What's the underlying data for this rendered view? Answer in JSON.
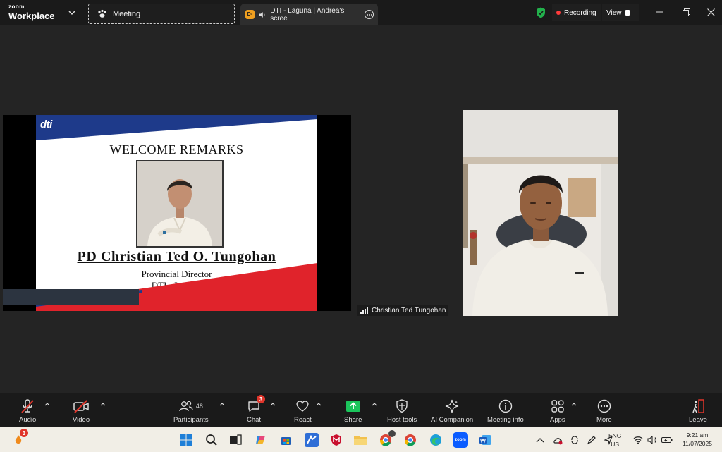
{
  "app": {
    "brand_small": "zoom",
    "brand_big": "Workplace"
  },
  "tabs": [
    {
      "label": "Meeting"
    },
    {
      "badge": "D-",
      "label": "DTI - Laguna | Andrea's scree"
    }
  ],
  "status": {
    "recording_label": "Recording",
    "view_label": "View"
  },
  "slide": {
    "logo_text": "dti",
    "title": "WELCOME REMARKS",
    "name": "PD Christian Ted O. Tungohan",
    "role": "Provincial Director",
    "org": "DTI - Laguna"
  },
  "participant": {
    "name": "Christian Ted Tungohan"
  },
  "toolbar": {
    "audio": "Audio",
    "video": "Video",
    "participants": "Participants",
    "participants_count": "48",
    "chat": "Chat",
    "chat_badge": "3",
    "react": "React",
    "share": "Share",
    "host_tools": "Host tools",
    "ai_companion": "AI Companion",
    "meeting_info": "Meeting info",
    "apps": "Apps",
    "more": "More",
    "leave": "Leave"
  },
  "taskbar": {
    "notif_badge": "3",
    "lang_top": "ENG",
    "lang_bottom": "US",
    "time": "9:21 am",
    "date": "11/07/2025",
    "zoom_label": "zoom"
  },
  "colors": {
    "accent_green": "#22b14c",
    "recording_red": "#ff3b3b",
    "share_green": "#1bc45b",
    "leave_red": "#e0352b",
    "slide_navy": "#1e3a8a",
    "slide_red": "#e0232b"
  }
}
